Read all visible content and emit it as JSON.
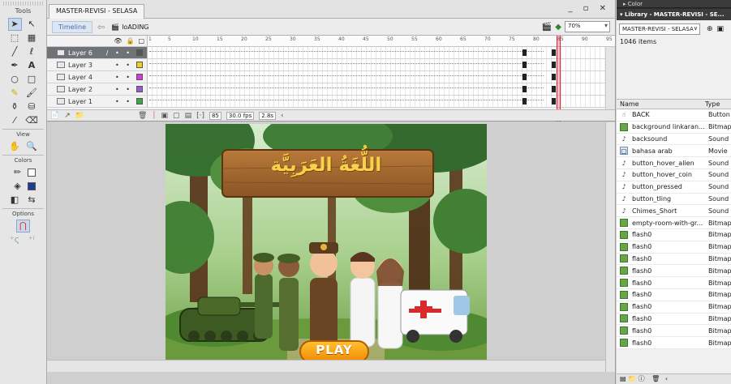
{
  "tools": {
    "title": "Tools",
    "view_label": "View",
    "colors_label": "Colors",
    "options_label": "Options"
  },
  "document": {
    "tab_title": "MASTER-REVISI - SELASA",
    "window_controls": "_ ▫ ✕",
    "timeline_button": "Timeline",
    "scene_name": "loADING",
    "zoom": "70%"
  },
  "timeline": {
    "ruler": [
      "1",
      "5",
      "10",
      "15",
      "20",
      "25",
      "30",
      "35",
      "40",
      "45",
      "50",
      "55",
      "60",
      "65",
      "70",
      "75",
      "80",
      "85",
      "90",
      "95"
    ],
    "playhead_frame": 85,
    "layers": [
      {
        "name": "Layer 6",
        "color": "#555555",
        "selected": true
      },
      {
        "name": "Layer 3",
        "color": "#f2d21a",
        "selected": false
      },
      {
        "name": "Layer 4",
        "color": "#d63cd6",
        "selected": false
      },
      {
        "name": "Layer 2",
        "color": "#9a5ad6",
        "selected": false
      },
      {
        "name": "Layer 1",
        "color": "#3aa848",
        "selected": false
      }
    ],
    "current_frame": "85",
    "fps": "30.0 fps",
    "time": "2.8s"
  },
  "stage": {
    "title_text": "اللُّغَةُ العَرَبِيَّة",
    "play_label": "PLAY"
  },
  "panels": {
    "color_header": "Color",
    "library_header": "Library - MASTER-REVISI - SE...",
    "library_select": "MASTER-REVISI - SELASA",
    "item_count": "1046 items",
    "col_name": "Name",
    "col_type": "Type",
    "items": [
      {
        "name": "BACK",
        "type": "Button",
        "icon": "btn"
      },
      {
        "name": "background linkaran...",
        "type": "Bitmap",
        "icon": "bmp"
      },
      {
        "name": "backsound",
        "type": "Sound",
        "icon": "snd"
      },
      {
        "name": "bahasa arab",
        "type": "Movie",
        "icon": "mov"
      },
      {
        "name": "button_hover_alien",
        "type": "Sound",
        "icon": "snd"
      },
      {
        "name": "button_hover_coin",
        "type": "Sound",
        "icon": "snd"
      },
      {
        "name": "button_pressed",
        "type": "Sound",
        "icon": "snd"
      },
      {
        "name": "button_tling",
        "type": "Sound",
        "icon": "snd"
      },
      {
        "name": "Chimes_Short",
        "type": "Sound",
        "icon": "snd"
      },
      {
        "name": "empty-room-with-gr...",
        "type": "Bitmap",
        "icon": "bmp"
      },
      {
        "name": "flash0",
        "type": "Bitmap",
        "icon": "bmp"
      },
      {
        "name": "flash0",
        "type": "Bitmap",
        "icon": "bmp"
      },
      {
        "name": "flash0",
        "type": "Bitmap",
        "icon": "bmp"
      },
      {
        "name": "flash0",
        "type": "Bitmap",
        "icon": "bmp"
      },
      {
        "name": "flash0",
        "type": "Bitmap",
        "icon": "bmp"
      },
      {
        "name": "flash0",
        "type": "Bitmap",
        "icon": "bmp"
      },
      {
        "name": "flash0",
        "type": "Bitmap",
        "icon": "bmp"
      },
      {
        "name": "flash0",
        "type": "Bitmap",
        "icon": "bmp"
      },
      {
        "name": "flash0",
        "type": "Bitmap",
        "icon": "bmp"
      },
      {
        "name": "flash0",
        "type": "Bitmap",
        "icon": "bmp"
      }
    ]
  }
}
